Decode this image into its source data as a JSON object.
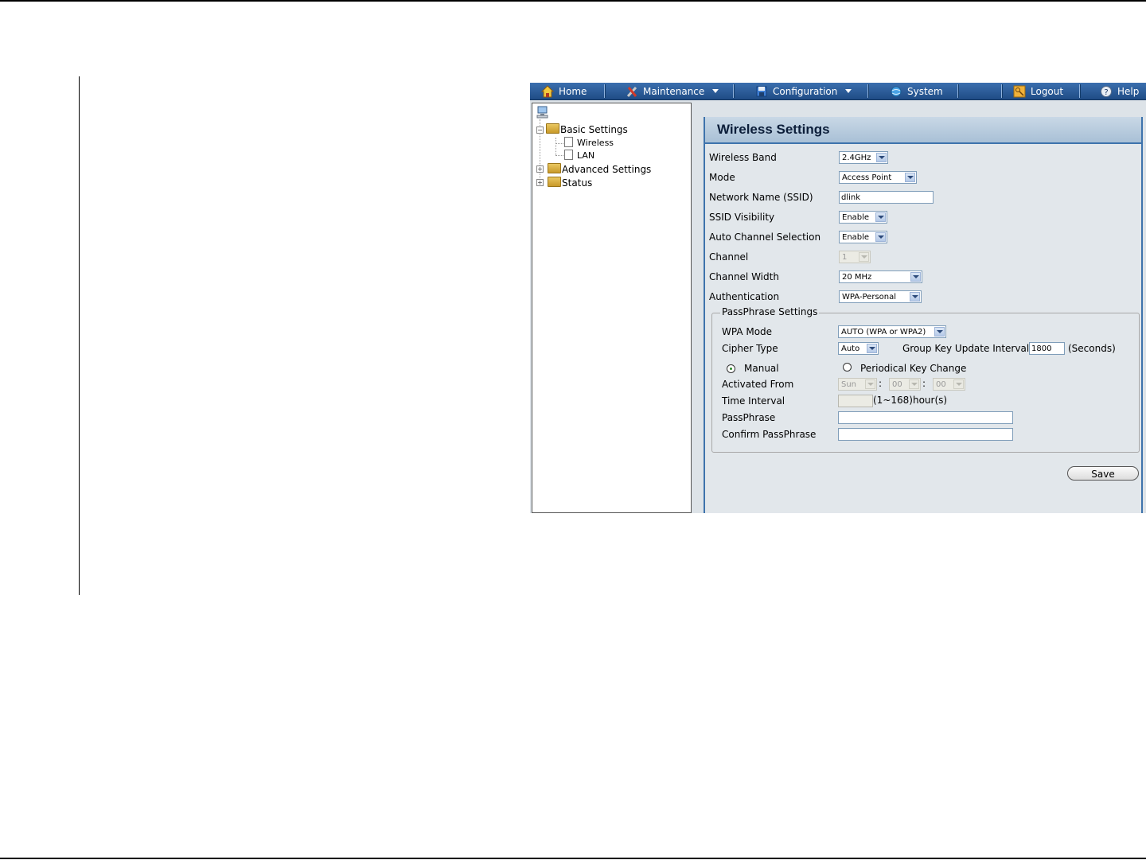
{
  "menu": {
    "home": "Home",
    "maintenance": "Maintenance",
    "configuration": "Configuration",
    "system": "System",
    "logout": "Logout",
    "help": "Help"
  },
  "tree": {
    "basic_settings": "Basic Settings",
    "wireless": "Wireless",
    "lan": "LAN",
    "advanced_settings": "Advanced Settings",
    "status": "Status"
  },
  "panel": {
    "title": "Wireless Settings",
    "wireless_band": {
      "label": "Wireless Band",
      "value": "2.4GHz"
    },
    "mode": {
      "label": "Mode",
      "value": "Access Point"
    },
    "ssid": {
      "label": "Network Name (SSID)",
      "value": "dlink"
    },
    "ssid_visibility": {
      "label": "SSID Visibility",
      "value": "Enable"
    },
    "auto_channel": {
      "label": "Auto Channel Selection",
      "value": "Enable"
    },
    "channel": {
      "label": "Channel",
      "value": "1"
    },
    "channel_width": {
      "label": "Channel Width",
      "value": "20 MHz"
    },
    "authentication": {
      "label": "Authentication",
      "value": "WPA-Personal"
    }
  },
  "passphrase": {
    "legend": "PassPhrase Settings",
    "wpa_mode": {
      "label": "WPA Mode",
      "value": "AUTO (WPA or WPA2)"
    },
    "cipher_type": {
      "label": "Cipher Type",
      "value": "Auto"
    },
    "group_key": {
      "label": "Group Key Update Interval",
      "value": "1800",
      "unit": "(Seconds)"
    },
    "manual": "Manual",
    "periodical": "Periodical Key Change",
    "activated_from": {
      "label": "Activated From",
      "day": "Sun",
      "hour": "00",
      "minute": "00",
      "sep": ":"
    },
    "time_interval": {
      "label": "Time Interval",
      "unit": "(1~168)hour(s)"
    },
    "passphrase_label": "PassPhrase",
    "confirm_label": "Confirm PassPhrase"
  },
  "buttons": {
    "save": "Save"
  },
  "colors": {
    "menubar": "#2a5b97",
    "accent": "#3e73ac",
    "panel_bg": "#e2e7eb"
  }
}
